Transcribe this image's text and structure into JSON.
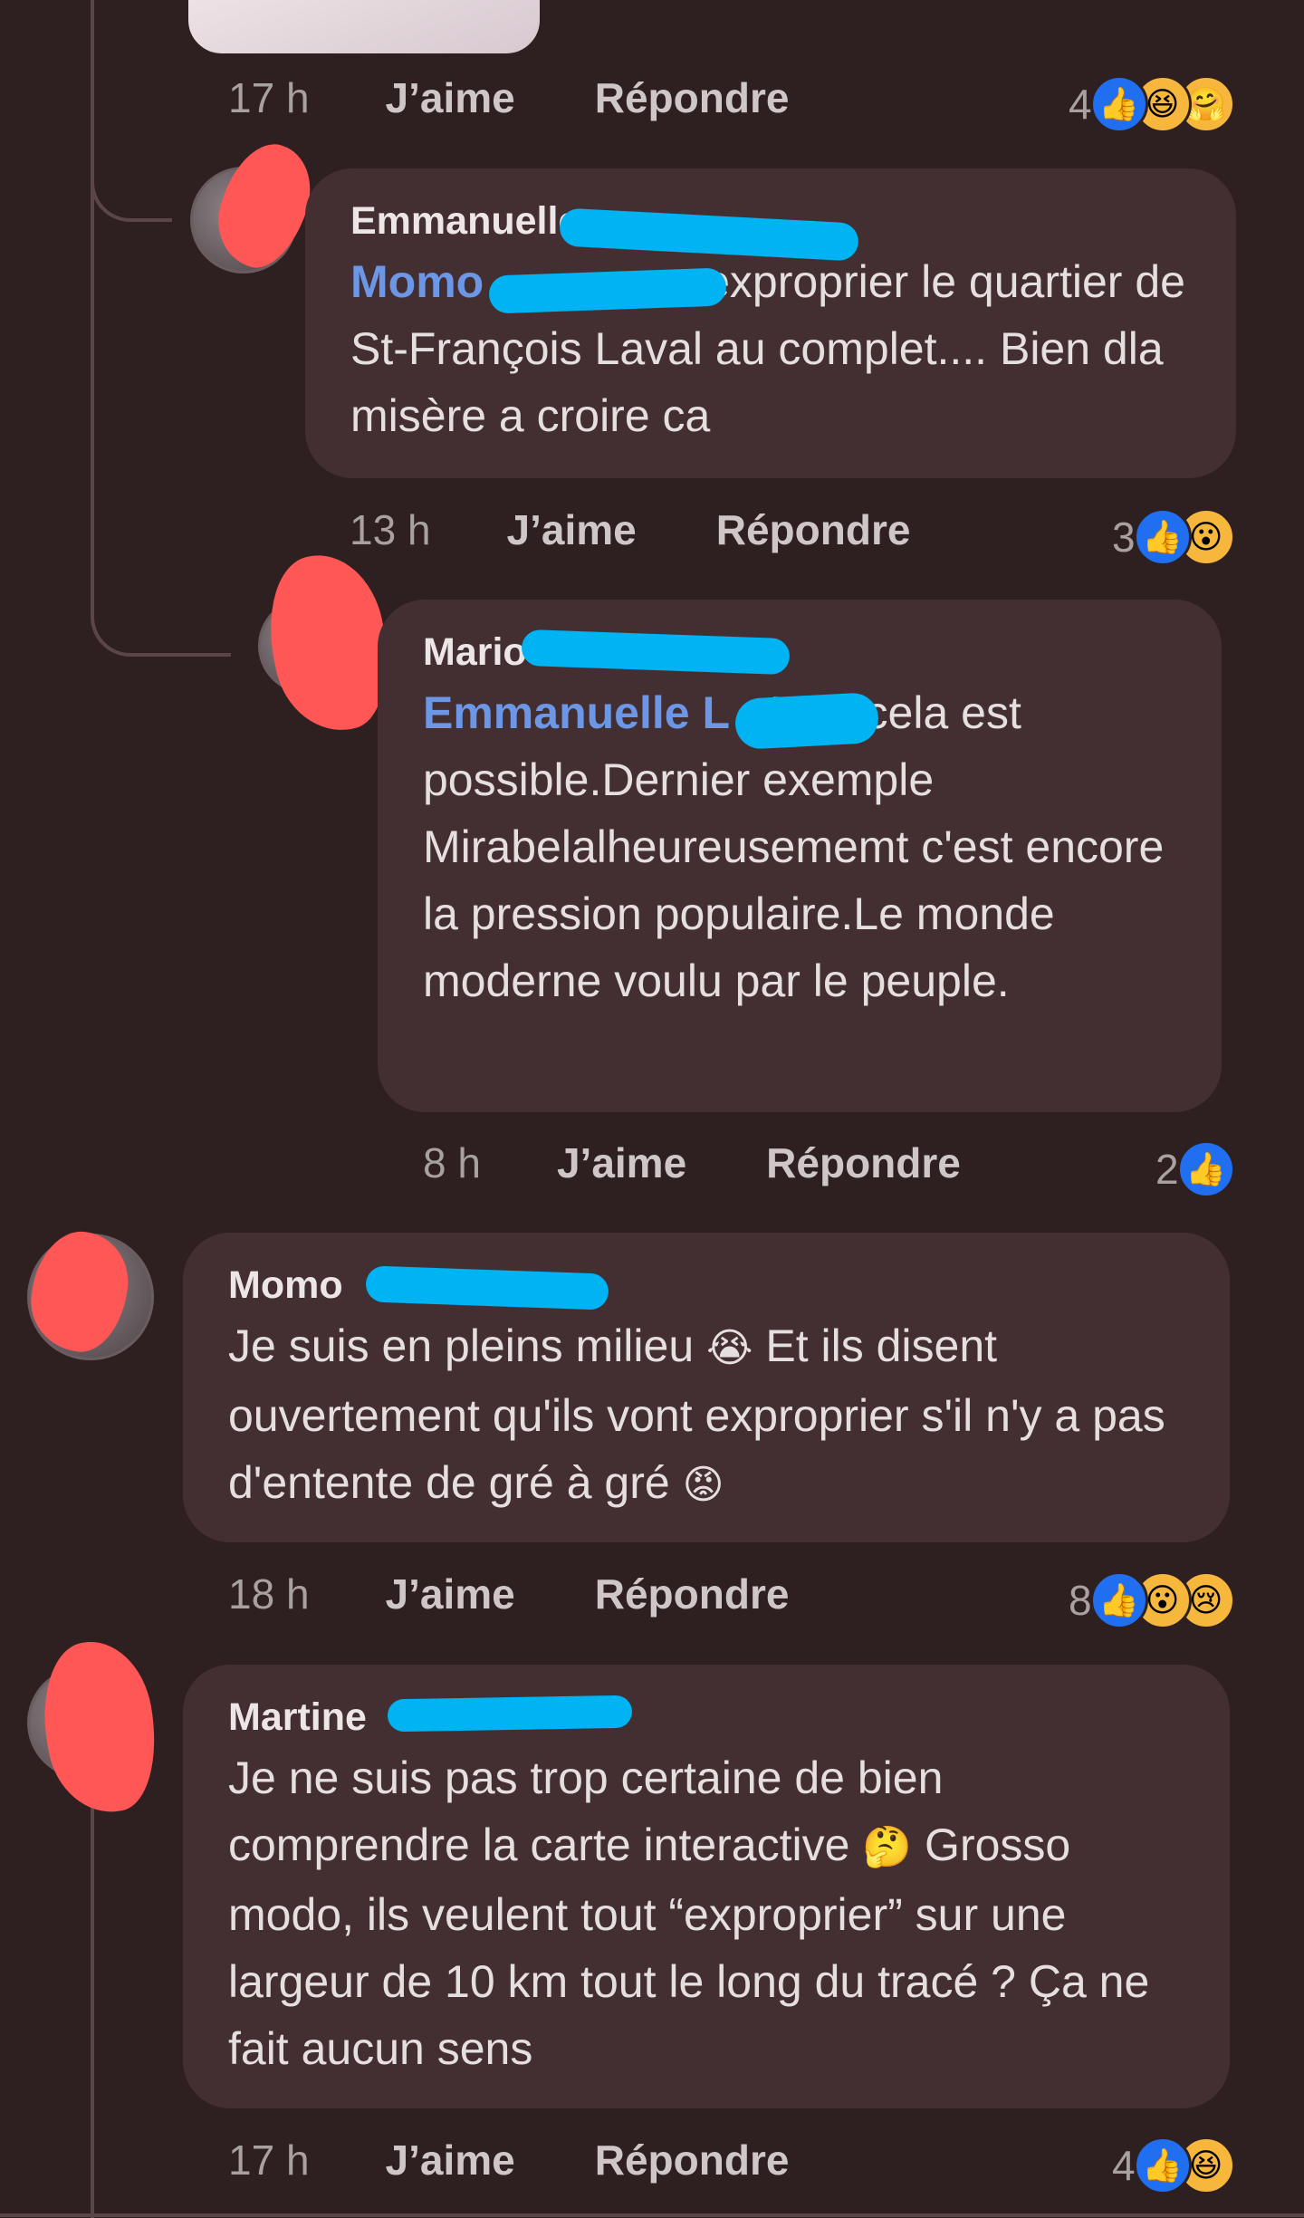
{
  "comments": [
    {
      "id": "top-stub",
      "meta": {
        "time": "17 h",
        "like": "J’aime",
        "reply": "Répondre",
        "count": "4",
        "reactions": [
          "like-icon",
          "haha-icon",
          "care-icon"
        ]
      }
    },
    {
      "id": "emmanuelle",
      "author": "Emmanuelle",
      "mention": "Momo",
      "text_line1": "exproprier le quartier",
      "text_rest": "de St-François Laval au complet.... Bien dla misère a croire ca",
      "meta": {
        "time": "13 h",
        "like": "J’aime",
        "reply": "Répondre",
        "count": "3",
        "reactions": [
          "like-icon",
          "wow-icon"
        ]
      }
    },
    {
      "id": "mario",
      "author": "Mario",
      "mention": "Emmanuelle L",
      "text_line1": "Non cela est",
      "text_rest": "possible.Dernier exemple Mirabelalheureusememt c'est encore la pression populaire.Le monde moderne voulu par le peuple.",
      "meta": {
        "time": "8 h",
        "like": "J’aime",
        "reply": "Répondre",
        "count": "2",
        "reactions": [
          "like-icon"
        ]
      }
    },
    {
      "id": "momo",
      "author": "Momo",
      "text_a": "Je suis en pleins milieu",
      "emoji_a": "😭",
      "text_b": "Et ils disent ouvertement qu'ils vont exproprier s'il n'y a pas d'entente de gré à gré",
      "emoji_b": "😡",
      "meta": {
        "time": "18 h",
        "like": "J’aime",
        "reply": "Répondre",
        "count": "8",
        "reactions": [
          "like-icon",
          "wow-icon",
          "sad-icon"
        ]
      }
    },
    {
      "id": "martine",
      "author": "Martine",
      "text_a": "Je ne suis pas trop certaine de bien comprendre la carte interactive",
      "emoji_a": "🤔",
      "text_b": "Grosso modo, ils veulent tout “exproprier” sur une largeur de 10 km tout le long du tracé ? Ça ne fait aucun sens",
      "meta": {
        "time": "17 h",
        "like": "J’aime",
        "reply": "Répondre",
        "count": "4",
        "reactions": [
          "like-icon",
          "haha-icon"
        ]
      }
    }
  ],
  "icons": {
    "like-icon": "👍",
    "haha-icon": "😆",
    "care-icon": "🤗",
    "wow-icon": "😮",
    "sad-icon": "😢"
  },
  "colors": {
    "background": "#2e1f21",
    "bubble": "#432f32",
    "mention": "#6b97e6",
    "like": "#1f6ff0",
    "redaction_blue": "#00b3f2",
    "redaction_red": "#ff5656"
  }
}
